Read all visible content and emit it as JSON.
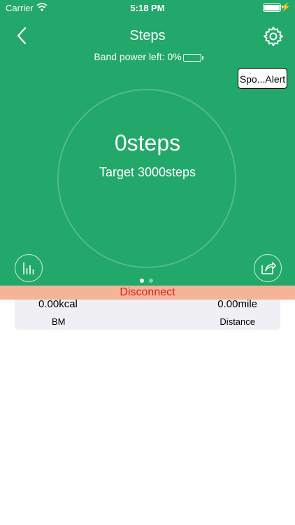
{
  "status_bar": {
    "carrier": "Carrier",
    "time": "5:18 PM"
  },
  "nav": {
    "title": "Steps"
  },
  "band": {
    "power_text": "Band power left: 0%"
  },
  "alert_button": {
    "label": "Spo...Alert"
  },
  "progress": {
    "steps_text": "0steps",
    "target_text": "Target 3000steps"
  },
  "pager": {
    "total": 2,
    "current": 1
  },
  "banner": {
    "disconnect": "Disconnect"
  },
  "stats": {
    "calories_value": "0.00kcal",
    "calories_label": "BM",
    "distance_value": "0.00mile",
    "distance_label": "Distance"
  },
  "colors": {
    "primary": "#22a86a",
    "banner_bg": "#f4b497",
    "banner_text": "#e02020"
  },
  "icons": [
    "back-chevron-icon",
    "gear-icon",
    "battery-icon",
    "chart-bars-icon",
    "share-icon",
    "wifi-icon"
  ]
}
